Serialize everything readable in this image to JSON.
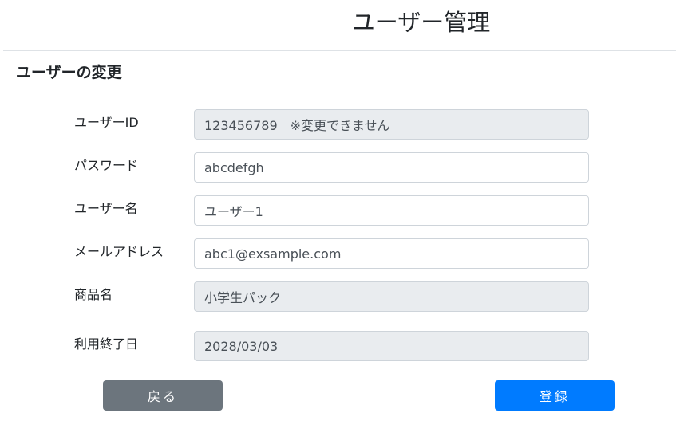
{
  "header": {
    "title": "ユーザー管理"
  },
  "section": {
    "title": "ユーザーの変更"
  },
  "form": {
    "user_id": {
      "label": "ユーザーID",
      "value": "123456789　※変更できません"
    },
    "password": {
      "label": "パスワード",
      "value": "abcdefgh"
    },
    "user_name": {
      "label": "ユーザー名",
      "value": "ユーザー1"
    },
    "email": {
      "label": "メールアドレス",
      "value": "abc1@exsample.com"
    },
    "product_name": {
      "label": "商品名",
      "value": "小学生パック"
    },
    "end_date": {
      "label": "利用終了日",
      "value": "2028/03/03"
    }
  },
  "actions": {
    "back_label": "戻る",
    "register_label": "登録"
  },
  "colors": {
    "primary": "#007bff",
    "secondary": "#6c757d",
    "readonly_bg": "#e9ecef",
    "border": "#ced4da"
  }
}
